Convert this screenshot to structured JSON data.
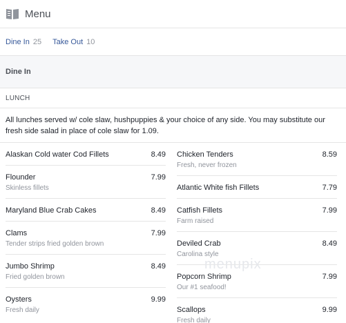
{
  "header": {
    "title": "Menu",
    "icon": "menu-book-icon"
  },
  "tabs": [
    {
      "label": "Dine In",
      "count": "25"
    },
    {
      "label": "Take Out",
      "count": "10"
    }
  ],
  "section": {
    "title": "Dine In",
    "subsection": "LUNCH",
    "description": "All lunches served w/ cole slaw, hushpuppies & your choice of any side. You may substitute our fresh side salad in place of cole slaw for 1.09."
  },
  "items_left": [
    {
      "name": "Alaskan Cold water Cod Fillets",
      "price": "8.49",
      "sub": ""
    },
    {
      "name": "Flounder",
      "price": "7.99",
      "sub": "Skinless fillets"
    },
    {
      "name": "Maryland Blue Crab Cakes",
      "price": "8.49",
      "sub": ""
    },
    {
      "name": "Clams",
      "price": "7.99",
      "sub": "Tender strips fried golden brown"
    },
    {
      "name": "Jumbo Shrimp",
      "price": "8.49",
      "sub": "Fried golden brown"
    },
    {
      "name": "Oysters",
      "price": "9.99",
      "sub": "Fresh daily"
    }
  ],
  "items_right": [
    {
      "name": "Chicken Tenders",
      "price": "8.59",
      "sub": "Fresh, never frozen"
    },
    {
      "name": "Atlantic White fish Fillets",
      "price": "7.79",
      "sub": ""
    },
    {
      "name": "Catfish Fillets",
      "price": "7.99",
      "sub": "Farm raised"
    },
    {
      "name": "Deviled Crab",
      "price": "8.49",
      "sub": "Carolina style"
    },
    {
      "name": "Popcorn Shrimp",
      "price": "7.99",
      "sub": "Our #1 seafood!"
    },
    {
      "name": "Scallops",
      "price": "9.99",
      "sub": "Fresh daily"
    }
  ],
  "watermark": "menupix"
}
